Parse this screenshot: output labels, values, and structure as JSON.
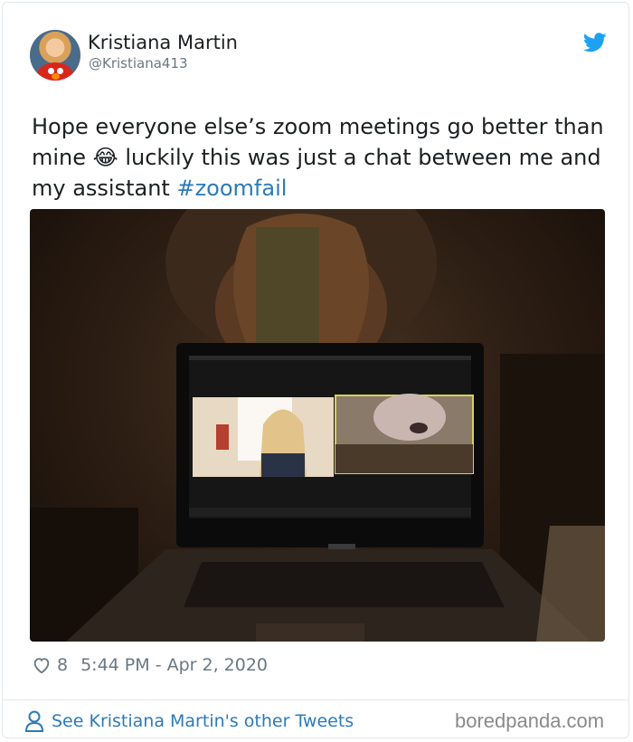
{
  "tweet": {
    "author_name": "Kristiana Martin",
    "author_handle": "@Kristiana413",
    "text_before": "Hope everyone else’s zoom meetings go better than mine ",
    "emoji": "😂",
    "text_after": " luckily this was just a chat between me and my assistant ",
    "hashtag": "#zoomfail",
    "likes": "8",
    "timestamp": "5:44 PM - Apr 2, 2020",
    "footer_link": "See Kristiana Martin's other Tweets",
    "icons": {
      "brand": "twitter-bird-icon",
      "like": "heart-icon",
      "profile": "person-icon"
    },
    "colors": {
      "link": "#2b7bb9",
      "brand": "#1da1f2",
      "meta": "#697882"
    }
  },
  "watermark": "boredpanda.com"
}
